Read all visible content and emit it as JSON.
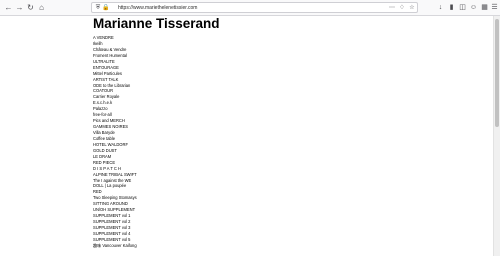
{
  "browser": {
    "url": "https://www.mariethelenetissier.com"
  },
  "page": {
    "title": "Marianne Tisserand",
    "menu": [
      "A VENDRE",
      "Ikeilh",
      "Château & Vendre",
      "Froment Humental",
      "ULTRALITE",
      "ENTOURAGE",
      "Mittel Particules",
      "ARTIST TALK",
      "ODE to the Librarian",
      "COATOUR",
      "Carrier Royale",
      "E.s.c.h.e.k",
      "Palazzo",
      "free-for-all",
      "Pics and MERCH",
      "GAMMES NOIRES",
      "Villa Baryde",
      "Coffee table",
      "HOTEL WALDORF",
      "GOLD DUST",
      "LE DRAM",
      "RED PIECE",
      "D I S P A T C H",
      "ALPINE TRIBAL SWIFT",
      "The I against the WE",
      "DOLL | La poupée",
      "RED",
      "Two Sleeping Stomasys",
      "SITTING AROUND",
      "UN/OH SUPPLEMENT",
      "SUPPLEMENT vol 1",
      "SUPPLEMENT vol 2",
      "SUPPLEMENT vol 3",
      "SUPPLEMENT vol 4",
      "SUPPLEMENT vol 5",
      "趣味 Vancouver Kaifong"
    ]
  }
}
